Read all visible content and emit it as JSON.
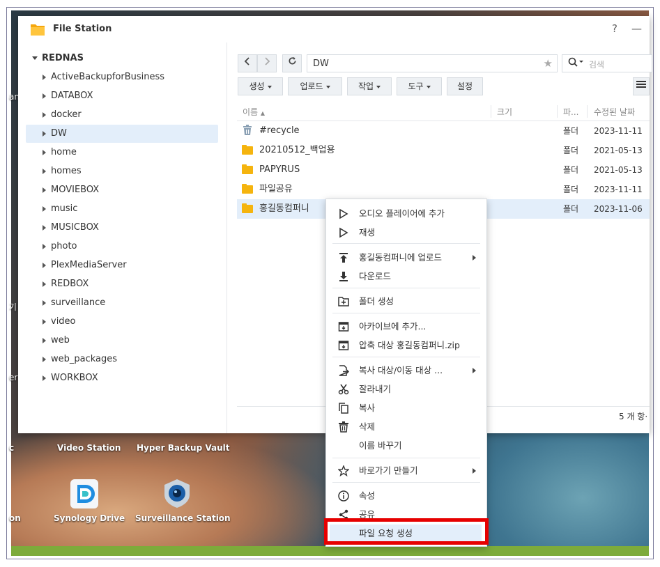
{
  "window": {
    "title": "File Station",
    "help": "?",
    "minimize": "—"
  },
  "desktop": {
    "icons": [
      {
        "label": "Video Station"
      },
      {
        "label": "Hyper Backup Vault"
      },
      {
        "label": "Synology Drive"
      },
      {
        "label": "Surveillance Station"
      }
    ],
    "edge_fragments": [
      "an",
      "기",
      "er",
      "c",
      "on"
    ]
  },
  "tree": {
    "root": "REDNAS",
    "items": [
      {
        "label": "ActiveBackupforBusiness"
      },
      {
        "label": "DATABOX"
      },
      {
        "label": "docker"
      },
      {
        "label": "DW"
      },
      {
        "label": "home"
      },
      {
        "label": "homes"
      },
      {
        "label": "MOVIEBOX"
      },
      {
        "label": "music"
      },
      {
        "label": "MUSICBOX"
      },
      {
        "label": "photo"
      },
      {
        "label": "PlexMediaServer"
      },
      {
        "label": "REDBOX"
      },
      {
        "label": "surveillance"
      },
      {
        "label": "video"
      },
      {
        "label": "web"
      },
      {
        "label": "web_packages"
      },
      {
        "label": "WORKBOX"
      }
    ],
    "selected": "DW"
  },
  "nav": {
    "path": "DW",
    "search_placeholder": "검색"
  },
  "toolbar": {
    "create": "생성",
    "upload": "업로드",
    "action": "작업",
    "tools": "도구",
    "settings": "설정"
  },
  "table": {
    "headers": {
      "name": "이름",
      "size": "크기",
      "type": "파...",
      "modified": "수정된 날짜"
    },
    "rows": [
      {
        "name": "#recycle",
        "type": "폴더",
        "modified": "2023-11-11",
        "icon": "trash-icon"
      },
      {
        "name": "20210512_백업용",
        "type": "폴더",
        "modified": "2021-05-13",
        "icon": "folder-icon"
      },
      {
        "name": "PAPYRUS",
        "type": "폴더",
        "modified": "2021-05-13",
        "icon": "folder-icon"
      },
      {
        "name": "파일공유",
        "type": "폴더",
        "modified": "2023-11-11",
        "icon": "folder-icon"
      },
      {
        "name": "홍길동컴퍼니",
        "type": "폴더",
        "modified": "2023-11-06",
        "icon": "folder-icon"
      }
    ],
    "count": "5 개 항·"
  },
  "context_menu": {
    "items": [
      {
        "label": "오디오 플레이어에 추가",
        "icon": "play-outline-icon"
      },
      {
        "label": "재생",
        "icon": "play-outline-icon"
      },
      {
        "label": "홍길동컴퍼니에 업로드",
        "icon": "upload-icon",
        "submenu": true
      },
      {
        "label": "다운로드",
        "icon": "download-icon"
      },
      {
        "label": "폴더 생성",
        "icon": "new-folder-icon"
      },
      {
        "label": "아카이브에 추가...",
        "icon": "archive-icon"
      },
      {
        "label": "압축 대상 홍길동컴퍼니.zip",
        "icon": "archive-icon"
      },
      {
        "label": "복사 대상/이동 대상 ...",
        "icon": "copy-move-icon",
        "submenu": true
      },
      {
        "label": "잘라내기",
        "icon": "scissors-icon"
      },
      {
        "label": "복사",
        "icon": "copy-icon"
      },
      {
        "label": "삭제",
        "icon": "trash-icon"
      },
      {
        "label": "이름 바꾸기",
        "icon": ""
      },
      {
        "label": "바로가기 만들기",
        "icon": "star-outline-icon",
        "submenu": true
      },
      {
        "label": "속성",
        "icon": "info-icon"
      },
      {
        "label": "공유",
        "icon": "share-icon"
      },
      {
        "label": "파일 요청 생성",
        "icon": ""
      }
    ],
    "highlighted": "파일 요청 생성"
  },
  "colors": {
    "selection": "#e3eefa",
    "folder": "#f5b40e",
    "highlight_box": "#e60000",
    "green_strip": "#7dab3b"
  }
}
